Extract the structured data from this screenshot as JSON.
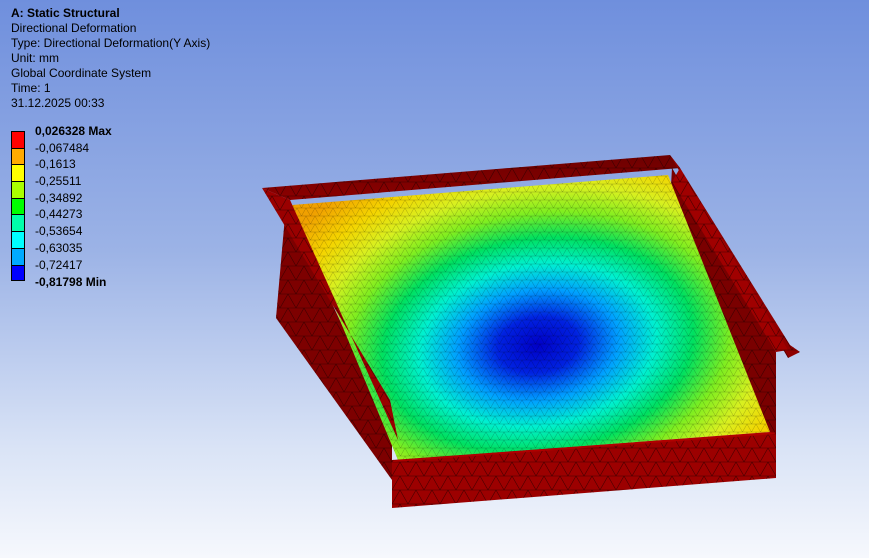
{
  "header": {
    "title": "A: Static Structural",
    "result_name": "Directional Deformation",
    "type": "Type: Directional Deformation(Y Axis)",
    "unit": "Unit: mm",
    "coord_system": "Global Coordinate System",
    "time": "Time: 1",
    "timestamp": "31.12.2025 00:33"
  },
  "legend": {
    "max_label": "0,026328 Max",
    "min_label": "-0,81798 Min",
    "levels": [
      "-0,067484",
      "-0,1613",
      "-0,25511",
      "-0,34892",
      "-0,44273",
      "-0,53654",
      "-0,63035",
      "-0,72417"
    ],
    "colors": [
      "#ff0000",
      "#ffaa00",
      "#ffff00",
      "#aaff00",
      "#00ff00",
      "#00ffaa",
      "#00ffff",
      "#00aaff",
      "#0000ff"
    ]
  },
  "model": {
    "wall_color": "#8b0000",
    "mesh_line_color": "#2a0000"
  }
}
